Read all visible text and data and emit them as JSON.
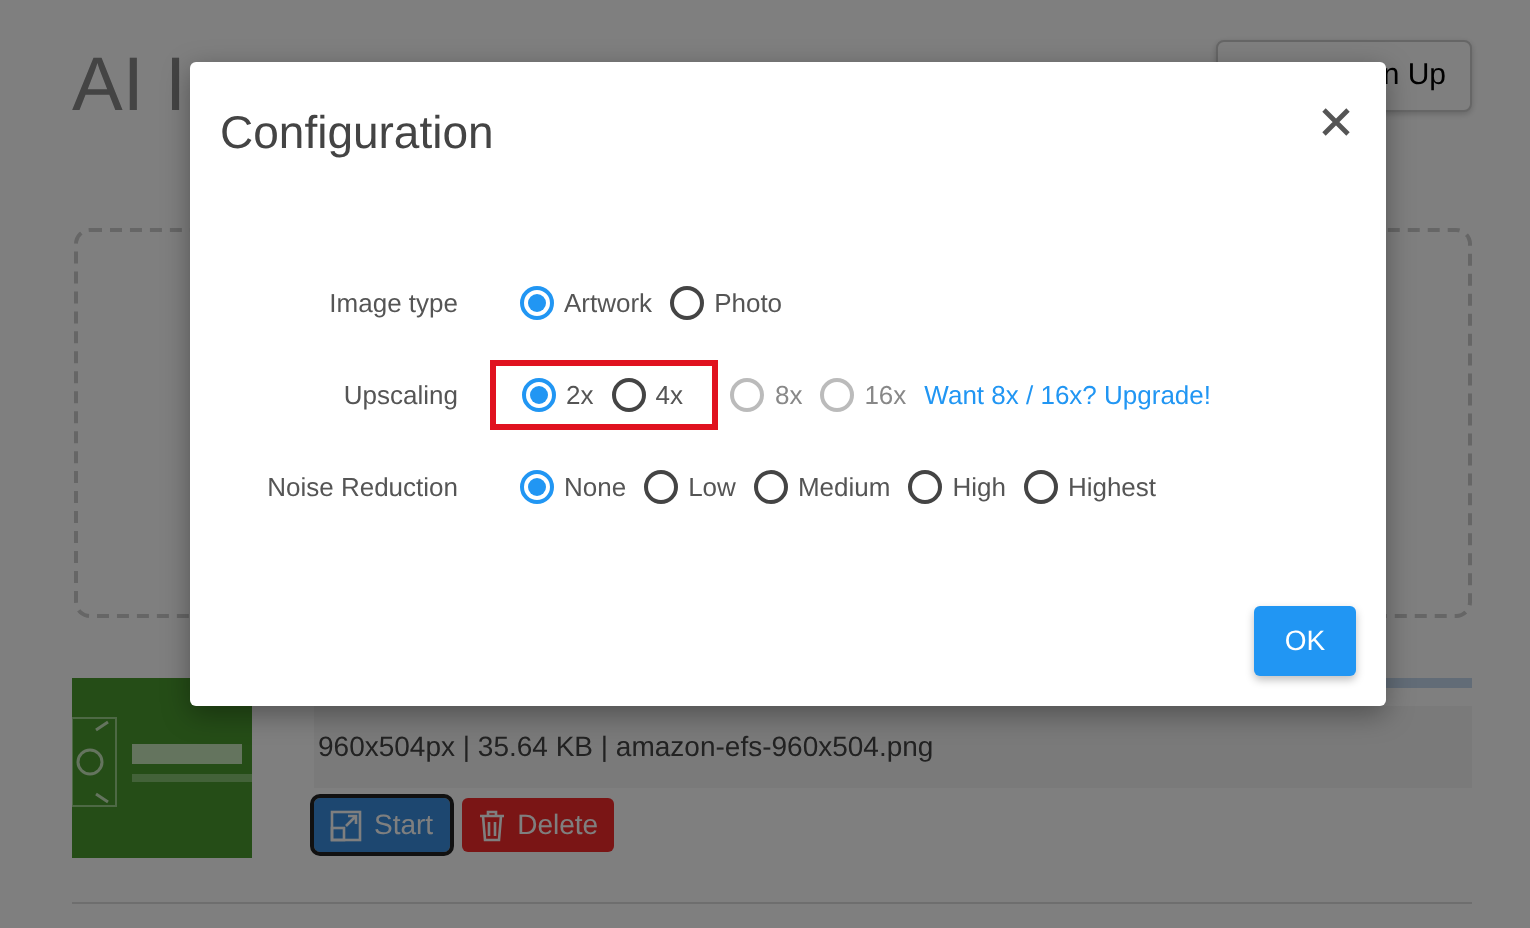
{
  "page": {
    "heading": "AI I",
    "signup_button": "n Up",
    "file": {
      "progress": {
        "level": 1
      },
      "info": "960x504px | 35.64 KB | amazon-efs-960x504.png",
      "buttons": [
        {
          "kind": "start",
          "label": "Start"
        },
        {
          "kind": "delete",
          "label": "Delete"
        }
      ]
    }
  },
  "modal": {
    "title": "Configuration",
    "rows": [
      {
        "label": "Image type",
        "options": [
          {
            "label": "Artwork",
            "selected": true,
            "disabled": false,
            "highlighted": false
          },
          {
            "label": "Photo",
            "selected": false,
            "disabled": false,
            "highlighted": false
          }
        ]
      },
      {
        "label": "Upscaling",
        "options": [
          {
            "label": "2x",
            "selected": true,
            "disabled": false,
            "highlighted": true
          },
          {
            "label": "4x",
            "selected": false,
            "disabled": false,
            "highlighted": true
          },
          {
            "label": "8x",
            "selected": false,
            "disabled": true,
            "highlighted": false
          },
          {
            "label": "16x",
            "selected": false,
            "disabled": true,
            "highlighted": false
          }
        ],
        "link": "Want 8x / 16x? Upgrade!"
      },
      {
        "label": "Noise Reduction",
        "options": [
          {
            "label": "None",
            "selected": true,
            "disabled": false,
            "highlighted": false
          },
          {
            "label": "Low",
            "selected": false,
            "disabled": false,
            "highlighted": false
          },
          {
            "label": "Medium",
            "selected": false,
            "disabled": false,
            "highlighted": false
          },
          {
            "label": "High",
            "selected": false,
            "disabled": false,
            "highlighted": false
          },
          {
            "label": "Highest",
            "selected": false,
            "disabled": false,
            "highlighted": false
          }
        ]
      }
    ],
    "ok_button": "OK"
  }
}
